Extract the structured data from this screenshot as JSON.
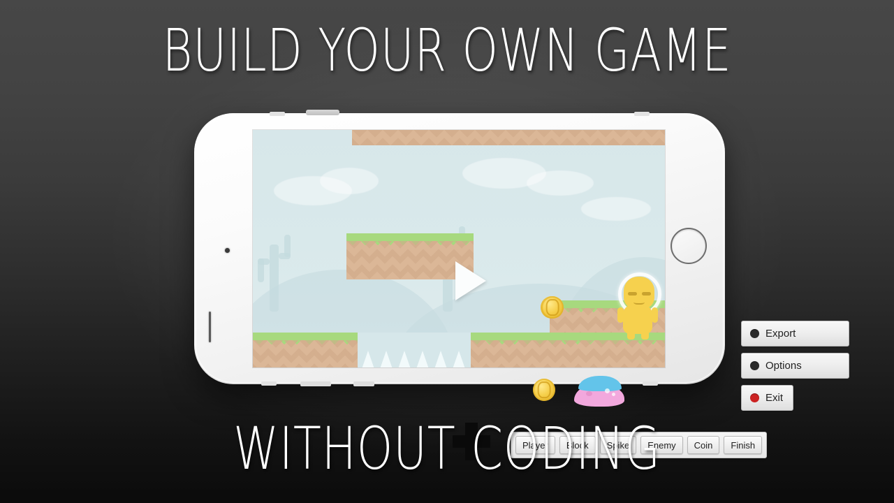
{
  "promo": {
    "headline": "BUILD YOUR OWN GAME",
    "subline": "WITHOUT CODING",
    "background_top_color": "#474747",
    "background_bottom_color": "#0b0b0b",
    "text_color": "#ffffff"
  },
  "device": {
    "name": "smartphone-mockup",
    "color": "#ffffff",
    "orientation": "landscape",
    "home_button": "home-button",
    "camera": "front-camera-dot",
    "earpiece": "earpiece-slit",
    "volume_button": "volume-button"
  },
  "app": {
    "screen_background": "#d9e8ea",
    "play_button_label": "play",
    "add_tool_label": "add",
    "menu": {
      "items": [
        {
          "label": "Export",
          "bullet_color": "#2b2b2b",
          "width": "wide"
        },
        {
          "label": "Options",
          "bullet_color": "#2b2b2b",
          "width": "wide"
        },
        {
          "label": "Exit",
          "bullet_color": "#cc2222",
          "width": "narrow"
        }
      ]
    },
    "palette": {
      "items": [
        {
          "label": "Player"
        },
        {
          "label": "Block"
        },
        {
          "label": "Spike"
        },
        {
          "label": "Enemy"
        },
        {
          "label": "Coin"
        },
        {
          "label": "Finish"
        }
      ]
    },
    "level": {
      "player": {
        "name": "player-character",
        "color": "#f6d14e",
        "helmet_color": "#ffffff"
      },
      "coins": [
        {
          "name": "coin-1"
        },
        {
          "name": "coin-2"
        }
      ],
      "enemy": {
        "name": "enemy-slime",
        "body_color": "#f2a8dd",
        "cap_color": "#63c4ea"
      },
      "terrain_colors": {
        "grass": "#a7d97e",
        "dirt": "#dbb797"
      },
      "spike_color": "#f2fafb",
      "sky_colors": {
        "top": "#d7e7ea",
        "bottom": "#e2eef0"
      }
    }
  }
}
